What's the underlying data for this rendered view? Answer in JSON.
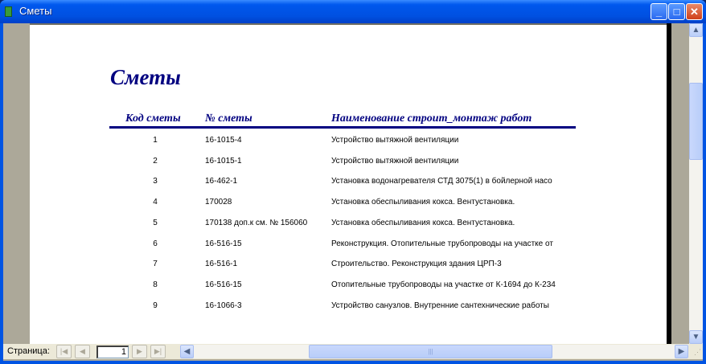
{
  "window": {
    "title": "Сметы"
  },
  "report": {
    "title": "Сметы",
    "headers": [
      "Код сметы",
      "№ сметы",
      "Наименование строит_монтаж работ"
    ],
    "rows": [
      [
        "1",
        "16-1015-4",
        "Устройство вытяжной вентиляции"
      ],
      [
        "2",
        "16-1015-1",
        "Устройство вытяжной вентиляции"
      ],
      [
        "3",
        "16-462-1",
        "Установка водонагревателя СТД 3075(1) в бойлерной насо"
      ],
      [
        "4",
        "170028",
        "Установка обеспыливания кокса. Вентустановка."
      ],
      [
        "5",
        "170138 доп.к см. № 156060",
        "Установка обеспыливания кокса. Вентустановка."
      ],
      [
        "6",
        "16-516-15",
        "Реконструкция. Отопительные трубопроводы на участке от"
      ],
      [
        "7",
        "16-516-1",
        "Строительство. Реконструкция здания ЦРП-3"
      ],
      [
        "8",
        "16-516-15",
        "Отопительные трубопроводы на участке от К-1694 до К-234"
      ],
      [
        "9",
        "16-1066-3",
        "Устройство санузлов. Внутренние сантехнические работы"
      ]
    ]
  },
  "nav": {
    "page_label": "Страница:",
    "page_value": "1"
  },
  "colors": {
    "accent": "#000080",
    "titlebar": "#0054e3"
  }
}
